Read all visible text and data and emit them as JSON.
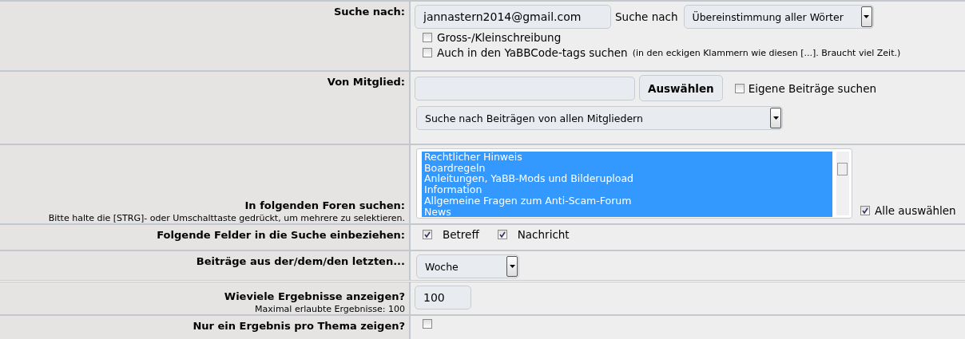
{
  "search_for": {
    "label": "Suche nach:",
    "query": "jannastern2014@gmail.com",
    "mode_label": "Suche nach",
    "mode": "Übereinstimmung aller Wörter",
    "case_sensitive": {
      "label": "Gross-/Kleinschreibung",
      "checked": false
    },
    "yabbcode": {
      "label": "Auch in den YaBBCode-tags suchen",
      "note": "(in den eckigen Klammern wie diesen [...]. Braucht viel Zeit.)",
      "checked": false
    }
  },
  "member": {
    "label": "Von Mitglied:",
    "button": "Auswählen",
    "own_posts": {
      "label": "Eigene Beiträge suchen",
      "checked": false
    },
    "scope": "Suche nach Beiträgen von allen Mitgliedern"
  },
  "forums": {
    "label": "In folgenden Foren suchen:",
    "hint": "Bitte halte die [STRG]- oder Umschalttaste gedrückt, um mehrere zu selektieren.",
    "items": [
      {
        "label": "Rechtlicher Hinweis",
        "selected": true
      },
      {
        "label": "Boardregeln",
        "selected": true
      },
      {
        "label": "Anleitungen, YaBB-Mods und Bilderupload",
        "selected": true
      },
      {
        "label": "Information",
        "selected": true
      },
      {
        "label": "Allgemeine Fragen zum Anti-Scam-Forum",
        "selected": true
      },
      {
        "label": "News",
        "selected": true
      }
    ],
    "select_all": {
      "label": "Alle auswählen",
      "checked": true
    }
  },
  "fields": {
    "label": "Folgende Felder in die Suche einbeziehen:",
    "options": [
      {
        "label": "Betreff",
        "checked": true
      },
      {
        "label": "Nachricht",
        "checked": true
      }
    ]
  },
  "age": {
    "label": "Beiträge aus der/dem/den letzten...",
    "value": "Woche"
  },
  "results": {
    "label": "Wieviele Ergebnisse anzeigen?",
    "hint": "Maximal erlaubte Ergebnisse: 100",
    "value": "100"
  },
  "one_per_topic": {
    "label": "Nur ein Ergebnis pro Thema zeigen?",
    "checked": false
  }
}
